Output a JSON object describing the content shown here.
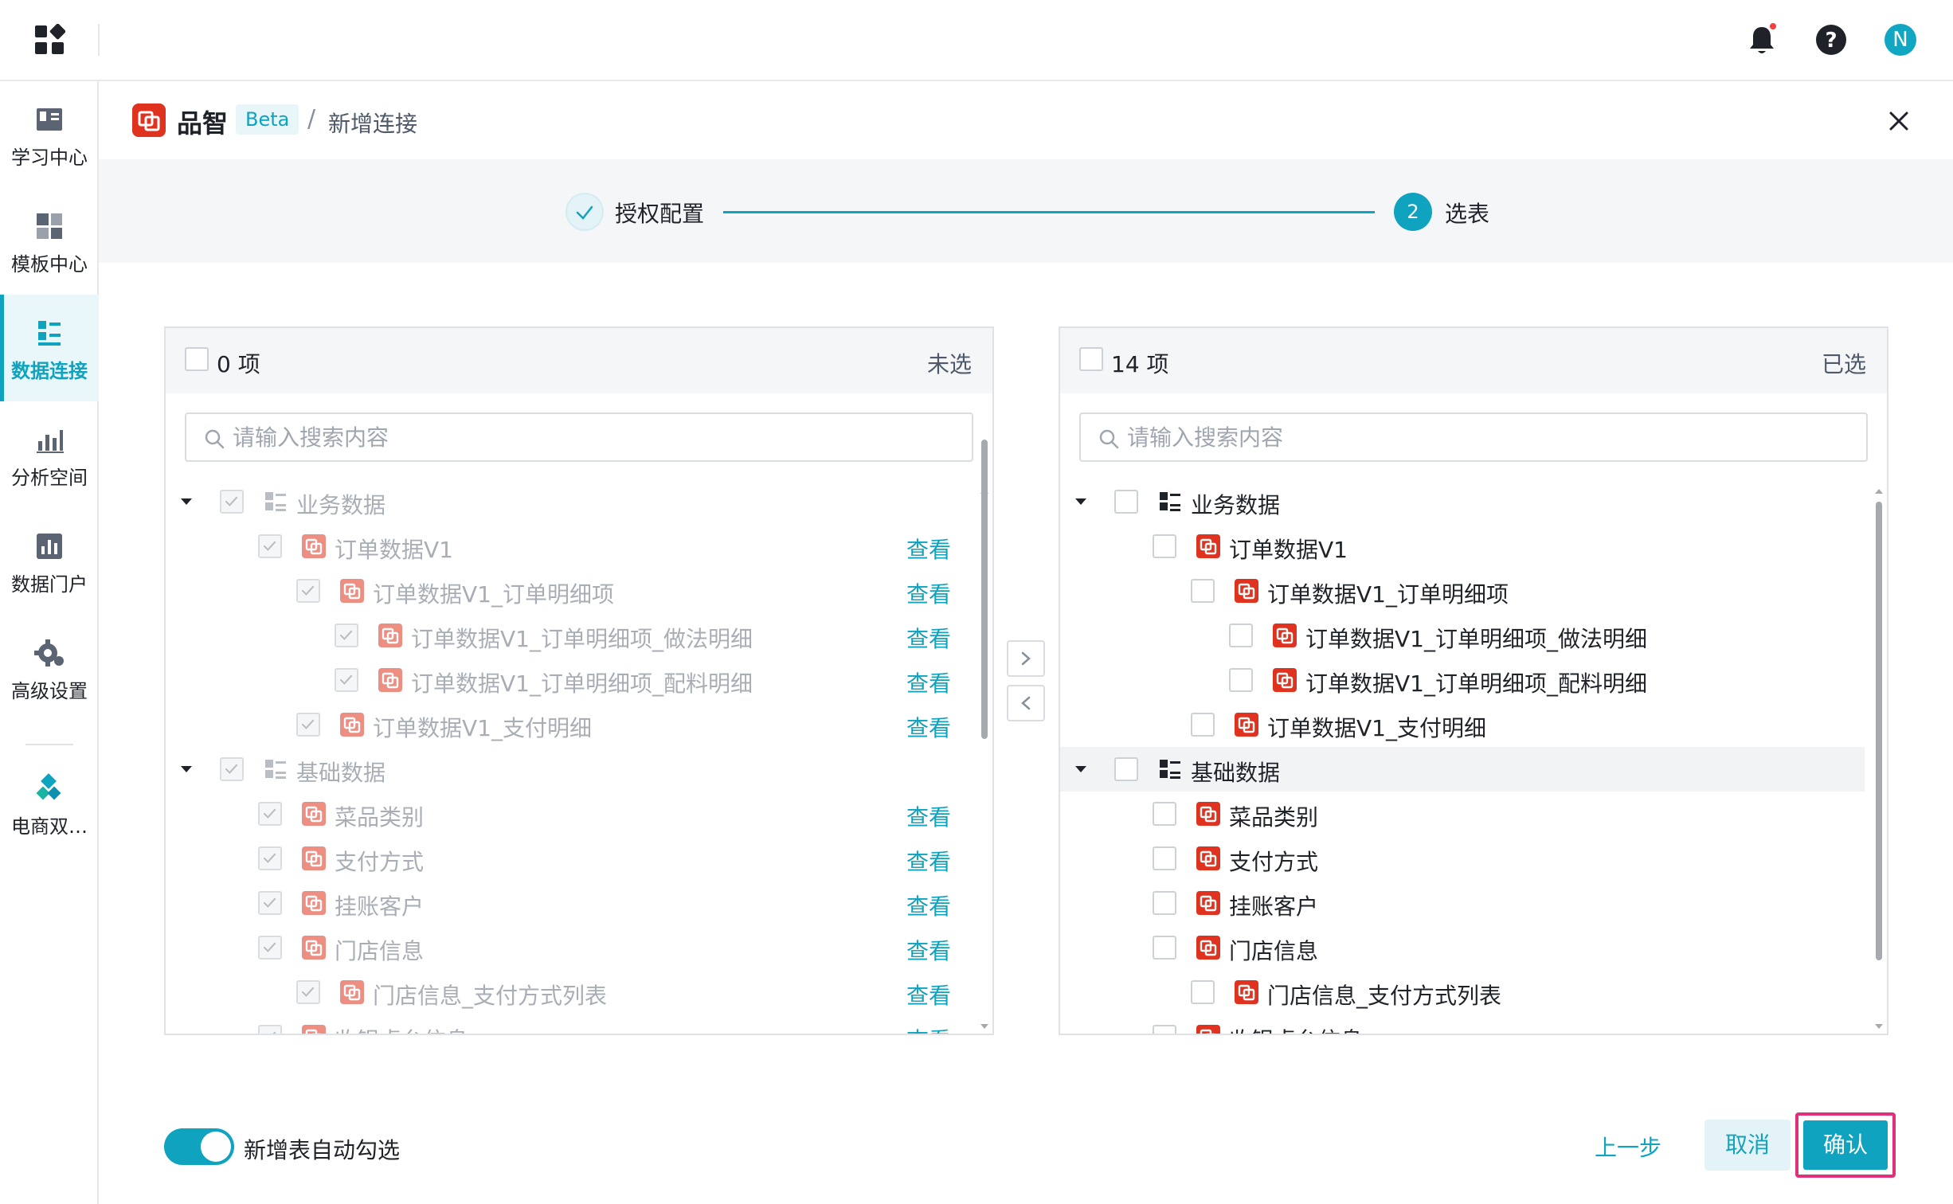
{
  "topbar": {
    "avatar_letter": "N",
    "notification_dot_color": "#f53f3f"
  },
  "sidebar": {
    "items": [
      {
        "label": "学习中心",
        "icon": "book-icon"
      },
      {
        "label": "模板中心",
        "icon": "template-icon"
      },
      {
        "label": "数据连接",
        "icon": "data-connection-icon",
        "active": true
      },
      {
        "label": "分析空间",
        "icon": "analysis-icon"
      },
      {
        "label": "数据门户",
        "icon": "portal-icon"
      },
      {
        "label": "高级设置",
        "icon": "settings-gear-icon"
      },
      {
        "label": "电商双…",
        "icon": "ecommerce-icon"
      }
    ]
  },
  "header": {
    "brand": "品智",
    "beta": "Beta",
    "separator": "/",
    "breadcrumb": "新增连接"
  },
  "steps": [
    {
      "label": "授权配置",
      "status": "done"
    },
    {
      "number": "2",
      "label": "选表",
      "status": "active"
    }
  ],
  "left_panel": {
    "count": "0 项",
    "status": "未选",
    "search_placeholder": "请输入搜索内容",
    "view_label": "查看",
    "rows": [
      {
        "label": "业务数据",
        "type": "folder"
      },
      {
        "label": "订单数据V1",
        "type": "table"
      },
      {
        "label": "订单数据V1_订单明细项",
        "type": "table"
      },
      {
        "label": "订单数据V1_订单明细项_做法明细",
        "type": "table"
      },
      {
        "label": "订单数据V1_订单明细项_配料明细",
        "type": "table"
      },
      {
        "label": "订单数据V1_支付明细",
        "type": "table"
      },
      {
        "label": "基础数据",
        "type": "folder"
      },
      {
        "label": "菜品类别",
        "type": "table"
      },
      {
        "label": "支付方式",
        "type": "table"
      },
      {
        "label": "挂账客户",
        "type": "table"
      },
      {
        "label": "门店信息",
        "type": "table"
      },
      {
        "label": "门店信息_支付方式列表",
        "type": "table"
      },
      {
        "label": "收银桌台信息",
        "type": "table"
      }
    ]
  },
  "right_panel": {
    "count": "14 项",
    "status": "已选",
    "search_placeholder": "请输入搜索内容",
    "rows": [
      {
        "label": "业务数据",
        "type": "folder"
      },
      {
        "label": "订单数据V1",
        "type": "table"
      },
      {
        "label": "订单数据V1_订单明细项",
        "type": "table"
      },
      {
        "label": "订单数据V1_订单明细项_做法明细",
        "type": "table"
      },
      {
        "label": "订单数据V1_订单明细项_配料明细",
        "type": "table"
      },
      {
        "label": "订单数据V1_支付明细",
        "type": "table"
      },
      {
        "label": "基础数据",
        "type": "folder"
      },
      {
        "label": "菜品类别",
        "type": "table"
      },
      {
        "label": "支付方式",
        "type": "table"
      },
      {
        "label": "挂账客户",
        "type": "table"
      },
      {
        "label": "门店信息",
        "type": "table"
      },
      {
        "label": "门店信息_支付方式列表",
        "type": "table"
      },
      {
        "label": "收银桌台信息",
        "type": "table"
      }
    ]
  },
  "transfer": {
    "right_arrow": ">",
    "left_arrow": "<"
  },
  "footer": {
    "toggle_label": "新增表自动勾选",
    "toggle_on": true,
    "prev_label": "上一步",
    "cancel_label": "取消",
    "confirm_label": "确认"
  },
  "colors": {
    "accent": "#0fa3bf",
    "brand_red": "#e0331f",
    "highlight_border": "#e0307a"
  }
}
